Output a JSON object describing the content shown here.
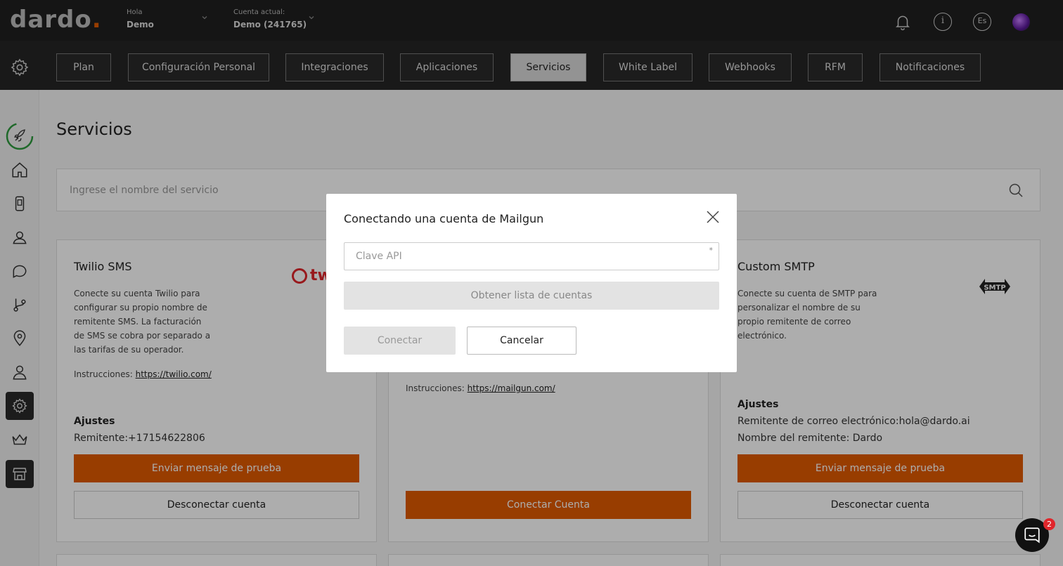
{
  "header": {
    "logo": "dardo",
    "logo_dot": ".",
    "greeting_label": "Hola",
    "greeting_name": "Demo",
    "account_label": "Cuenta actual:",
    "account_name": "Demo (241765)",
    "info_icon_glyph": "i",
    "language": "Es"
  },
  "tabs": [
    {
      "label": "Plan"
    },
    {
      "label": "Configuración Personal"
    },
    {
      "label": "Integraciones"
    },
    {
      "label": "Aplicaciones"
    },
    {
      "label": "Servicios",
      "active": true
    },
    {
      "label": "White Label"
    },
    {
      "label": "Webhooks"
    },
    {
      "label": "RFM"
    },
    {
      "label": "Notificaciones"
    }
  ],
  "sidebar": {
    "items": [
      {
        "icon": "rocket-icon"
      },
      {
        "icon": "home-icon"
      },
      {
        "icon": "device-icon"
      },
      {
        "icon": "users-icon"
      },
      {
        "icon": "chat-icon"
      },
      {
        "icon": "flow-icon"
      },
      {
        "icon": "location-icon"
      },
      {
        "icon": "user-icon"
      },
      {
        "icon": "gear-icon",
        "active": true
      },
      {
        "icon": "crown-icon"
      },
      {
        "icon": "store-icon",
        "active": true
      }
    ]
  },
  "main": {
    "title": "Servicios",
    "search_placeholder": "Ingrese el nombre del servicio"
  },
  "cards": {
    "twilio": {
      "title": "Twilio SMS",
      "logo_text": "twilio",
      "description": "Conecte su cuenta Twilio para configurar su propio nombre de remitente SMS. La facturación de SMS se cobra por separado a las tarifas de su operador.",
      "instructions_label": "Instrucciones:",
      "instructions_link": "https://twilio.com/",
      "settings_label": "Ajustes",
      "sender_label": "Remitente:",
      "sender_value": "+17154622806",
      "test_button": "Enviar mensaje de prueba",
      "disconnect_button": "Desconectar cuenta"
    },
    "mailgun": {
      "instructions_label": "Instrucciones:",
      "instructions_link": "https://mailgun.com/",
      "connect_button": "Conectar Cuenta"
    },
    "smtp": {
      "title": "Custom SMTP",
      "logo_text": "SMTP",
      "description": "Conecte su cuenta de SMTP para personalizar el nombre de su propio remitente de correo electrónico.",
      "settings_label": "Ajustes",
      "email_label": "Remitente de correo electrónico:",
      "email_value": "hola@dardo.ai",
      "name_label": "Nombre del remitente:",
      "name_value": " Dardo",
      "test_button": "Enviar mensaje de prueba",
      "disconnect_button": "Desconectar cuenta"
    }
  },
  "modal": {
    "title": "Conectando una cuenta de Mailgun",
    "api_key_placeholder": "Clave API",
    "required_mark": "*",
    "get_accounts_button": "Obtener lista de cuentas",
    "connect_button": "Conectar",
    "cancel_button": "Cancelar"
  },
  "chat": {
    "badge_count": "2"
  },
  "colors": {
    "accent": "#e05a00",
    "dark": "#1f1f1f"
  }
}
